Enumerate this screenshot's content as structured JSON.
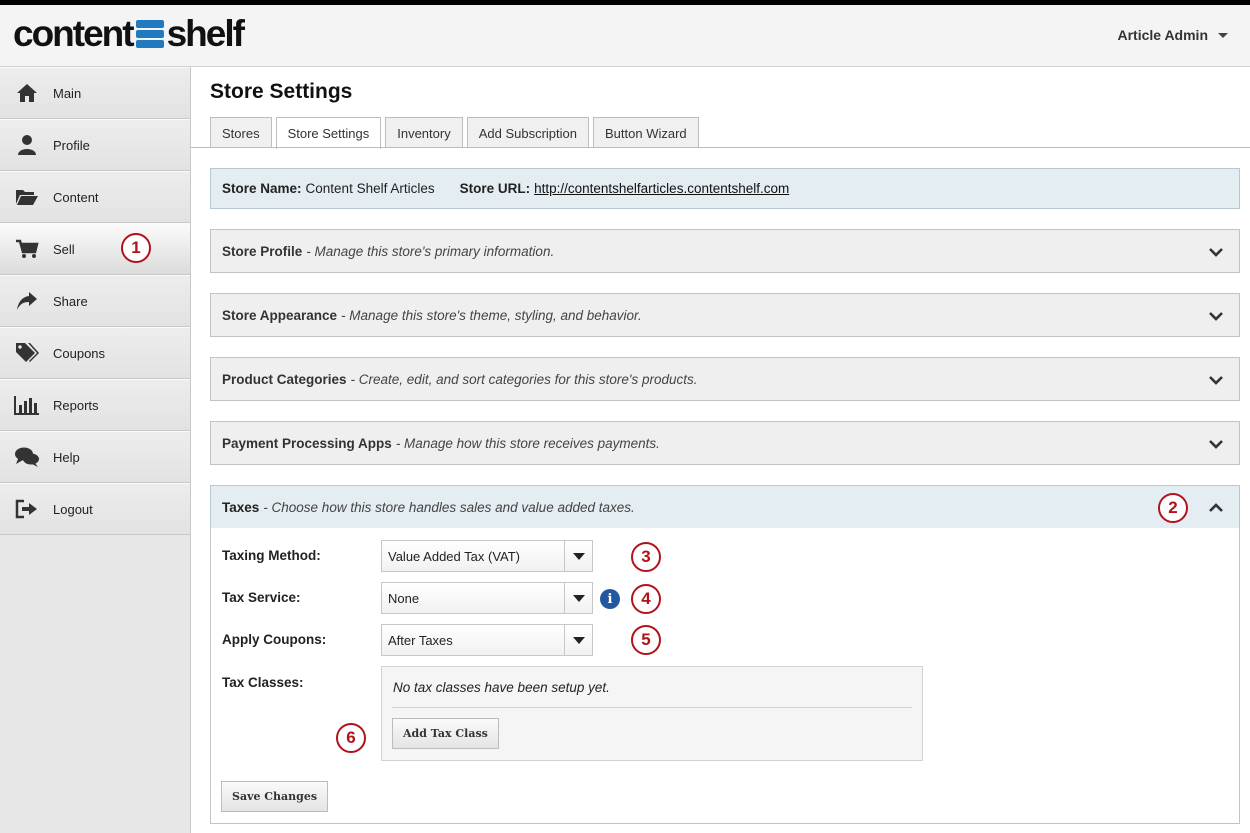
{
  "header": {
    "logo_left": "content",
    "logo_right": "shelf",
    "user_label": "Article Admin"
  },
  "sidebar": {
    "items": [
      {
        "label": "Main",
        "icon": "home-icon"
      },
      {
        "label": "Profile",
        "icon": "user-icon"
      },
      {
        "label": "Content",
        "icon": "folder-open-icon"
      },
      {
        "label": "Sell",
        "icon": "cart-icon"
      },
      {
        "label": "Share",
        "icon": "share-arrow-icon"
      },
      {
        "label": "Coupons",
        "icon": "tags-icon"
      },
      {
        "label": "Reports",
        "icon": "bar-chart-icon"
      },
      {
        "label": "Help",
        "icon": "chat-bubbles-icon"
      },
      {
        "label": "Logout",
        "icon": "logout-icon"
      }
    ],
    "active": "Sell"
  },
  "main": {
    "title": "Store Settings",
    "tabs": [
      "Stores",
      "Store Settings",
      "Inventory",
      "Add Subscription",
      "Button Wizard"
    ],
    "active_tab": "Store Settings",
    "store_info": {
      "name_label": "Store Name:",
      "name_value": "Content Shelf Articles",
      "url_label": "Store URL:",
      "url_value": "http://contentshelfarticles.contentshelf.com"
    },
    "panels": [
      {
        "title": "Store Profile",
        "desc": "- Manage this store's primary information."
      },
      {
        "title": "Store Appearance",
        "desc": "- Manage this store's theme, styling, and behavior."
      },
      {
        "title": "Product Categories",
        "desc": "- Create, edit, and sort categories for this store's products."
      },
      {
        "title": "Payment Processing Apps",
        "desc": "- Manage how this store receives payments."
      }
    ],
    "taxes": {
      "title": "Taxes",
      "desc": "- Choose how this store handles sales and value added taxes.",
      "taxing_method_label": "Taxing Method:",
      "taxing_method_value": "Value Added Tax (VAT)",
      "tax_service_label": "Tax Service:",
      "tax_service_value": "None",
      "apply_coupons_label": "Apply Coupons:",
      "apply_coupons_value": "After Taxes",
      "tax_classes_label": "Tax Classes:",
      "tax_classes_empty": "No tax classes have been setup yet.",
      "add_tax_class_label": "Add Tax Class",
      "save_label": "Save Changes"
    }
  },
  "callouts": [
    "1",
    "2",
    "3",
    "4",
    "5",
    "6"
  ],
  "colors": {
    "brand_blue": "#1f7ac0",
    "callout_red": "#b0141a",
    "info_blue": "#2358a0",
    "highlight_panel": "#e3edf2"
  }
}
